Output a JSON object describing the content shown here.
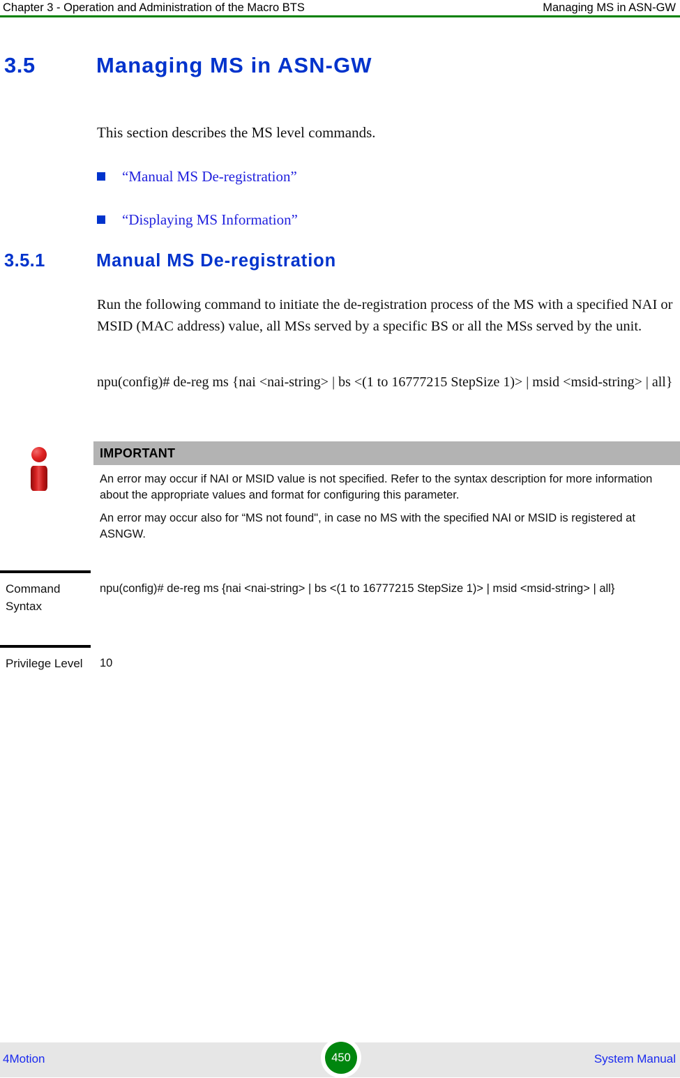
{
  "header": {
    "left": "Chapter 3 - Operation and Administration of the Macro BTS",
    "right": "Managing MS in ASN-GW",
    "rule_color": "#008000"
  },
  "section": {
    "number": "3.5",
    "title": "Managing MS in ASN-GW",
    "intro": "This section describes the MS level commands.",
    "heading_color": "#0033cc"
  },
  "links": [
    {
      "label": "“Manual MS De-registration”"
    },
    {
      "label": "“Displaying MS Information”"
    }
  ],
  "subsection": {
    "number": "3.5.1",
    "title": "Manual MS De-registration",
    "paragraph": "Run the following command to initiate the de-registration process of the MS with a specified NAI or MSID (MAC address) value, all MSs served by a specific BS or all the MSs served by the unit.",
    "command": "npu(config)# de-reg ms {nai <nai-string> | bs <(1 to 16777215 StepSize 1)> | msid <msid-string> | all}"
  },
  "note": {
    "icon": "info-icon",
    "title": "IMPORTANT",
    "banner_color": "#b3b3b3",
    "paragraphs": [
      "An error may occur if NAI or MSID value is not specified. Refer to the syntax description for more information about the appropriate values and format for configuring this parameter.",
      "An error may occur also for “MS not found\", in case no MS with the specified NAI or MSID is registered at ASNGW."
    ]
  },
  "param_table": {
    "rows": [
      {
        "label": "Command Syntax",
        "value": "npu(config)# de-reg ms {nai <nai-string> | bs <(1 to 16777215 StepSize 1)> | msid <msid-string> | all}"
      },
      {
        "label": "Privilege Level",
        "value": "10"
      }
    ]
  },
  "footer": {
    "left": "4Motion",
    "page_number": "450",
    "right": "System Manual",
    "band_color": "#e6e6e6",
    "badge_color": "#00860e"
  }
}
